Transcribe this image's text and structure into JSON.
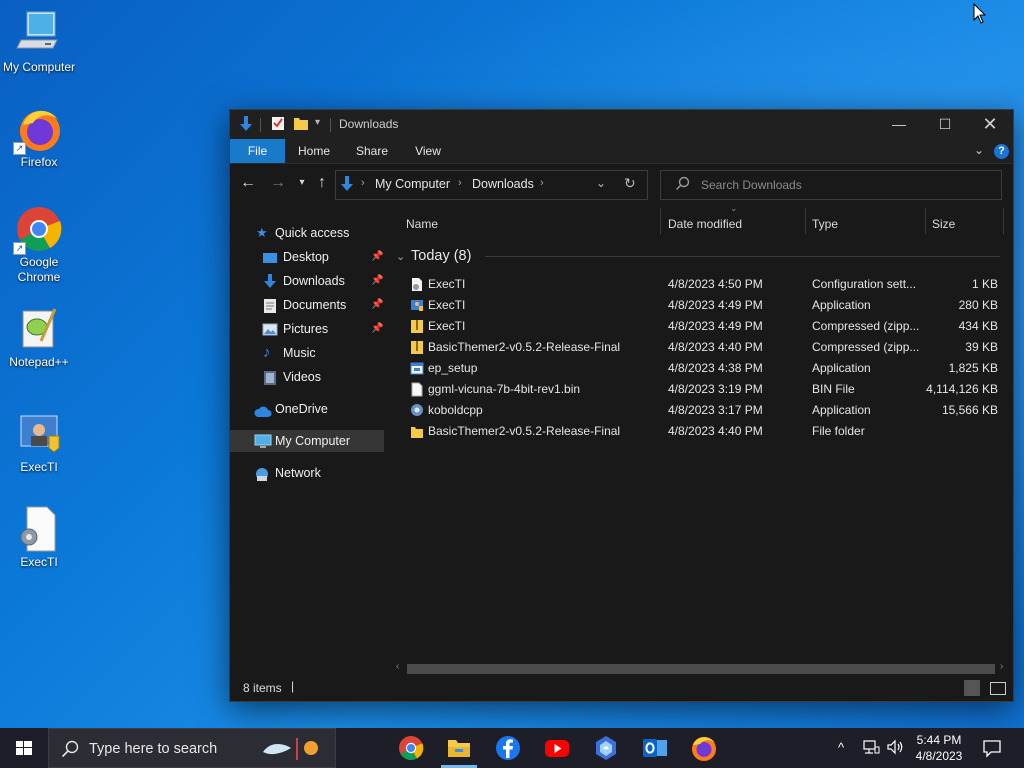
{
  "desktop": {
    "icons": [
      {
        "label": "My Computer",
        "icon": "computer-icon"
      },
      {
        "label": "Firefox",
        "icon": "firefox-icon"
      },
      {
        "label": "Google Chrome",
        "icon": "chrome-icon"
      },
      {
        "label": "Notepad++",
        "icon": "notepad-plus-plus-icon"
      },
      {
        "label": "ExecTI",
        "icon": "execti-app-icon"
      },
      {
        "label": "ExecTI",
        "icon": "execti-config-icon"
      }
    ]
  },
  "explorer": {
    "title": "Downloads",
    "ribbon_tabs": [
      "File",
      "Home",
      "Share",
      "View"
    ],
    "address": {
      "segments": [
        "My Computer",
        "Downloads"
      ]
    },
    "search_placeholder": "Search Downloads",
    "nav": [
      {
        "label": "Quick access",
        "icon": "star-icon"
      },
      {
        "label": "Desktop",
        "icon": "desktop-folder-icon",
        "pinned": true
      },
      {
        "label": "Downloads",
        "icon": "download-arrow-icon",
        "pinned": true
      },
      {
        "label": "Documents",
        "icon": "documents-icon",
        "pinned": true
      },
      {
        "label": "Pictures",
        "icon": "pictures-icon",
        "pinned": true
      },
      {
        "label": "Music",
        "icon": "music-note-icon"
      },
      {
        "label": "Videos",
        "icon": "videos-icon"
      },
      {
        "label": "OneDrive",
        "icon": "cloud-icon"
      },
      {
        "label": "My Computer",
        "icon": "computer-icon",
        "selected": true
      },
      {
        "label": "Network",
        "icon": "network-icon"
      }
    ],
    "columns": [
      "Name",
      "Date modified",
      "Type",
      "Size"
    ],
    "group": "Today (8)",
    "files": [
      {
        "name": "ExecTI",
        "date": "4/8/2023 4:50 PM",
        "type": "Configuration sett...",
        "size": "1 KB",
        "icon": "config-file-icon"
      },
      {
        "name": "ExecTI",
        "date": "4/8/2023 4:49 PM",
        "type": "Application",
        "size": "280 KB",
        "icon": "application-icon"
      },
      {
        "name": "ExecTI",
        "date": "4/8/2023 4:49 PM",
        "type": "Compressed (zipp...",
        "size": "434 KB",
        "icon": "zip-folder-icon"
      },
      {
        "name": "BasicThemer2-v0.5.2-Release-Final",
        "date": "4/8/2023 4:40 PM",
        "type": "Compressed (zipp...",
        "size": "39 KB",
        "icon": "zip-folder-icon"
      },
      {
        "name": "ep_setup",
        "date": "4/8/2023 4:38 PM",
        "type": "Application",
        "size": "1,825 KB",
        "icon": "installer-icon"
      },
      {
        "name": "ggml-vicuna-7b-4bit-rev1.bin",
        "date": "4/8/2023 3:19 PM",
        "type": "BIN File",
        "size": "4,114,126 KB",
        "icon": "blank-file-icon"
      },
      {
        "name": "koboldcpp",
        "date": "4/8/2023 3:17 PM",
        "type": "Application",
        "size": "15,566 KB",
        "icon": "application-icon"
      },
      {
        "name": "BasicThemer2-v0.5.2-Release-Final",
        "date": "4/8/2023 4:40 PM",
        "type": "File folder",
        "size": "",
        "icon": "folder-icon"
      }
    ],
    "status": "8 items"
  },
  "taskbar": {
    "search_placeholder": "Type here to search",
    "apps": [
      "chrome-icon",
      "file-explorer-icon",
      "facebook-icon",
      "youtube-icon",
      "copilot-icon",
      "outlook-icon",
      "firefox-icon"
    ],
    "time": "5:44 PM",
    "date": "4/8/2023"
  },
  "colors": {
    "accent": "#1979ca",
    "window_bg": "#191919",
    "taskbar_bg": "#1e1e28"
  }
}
